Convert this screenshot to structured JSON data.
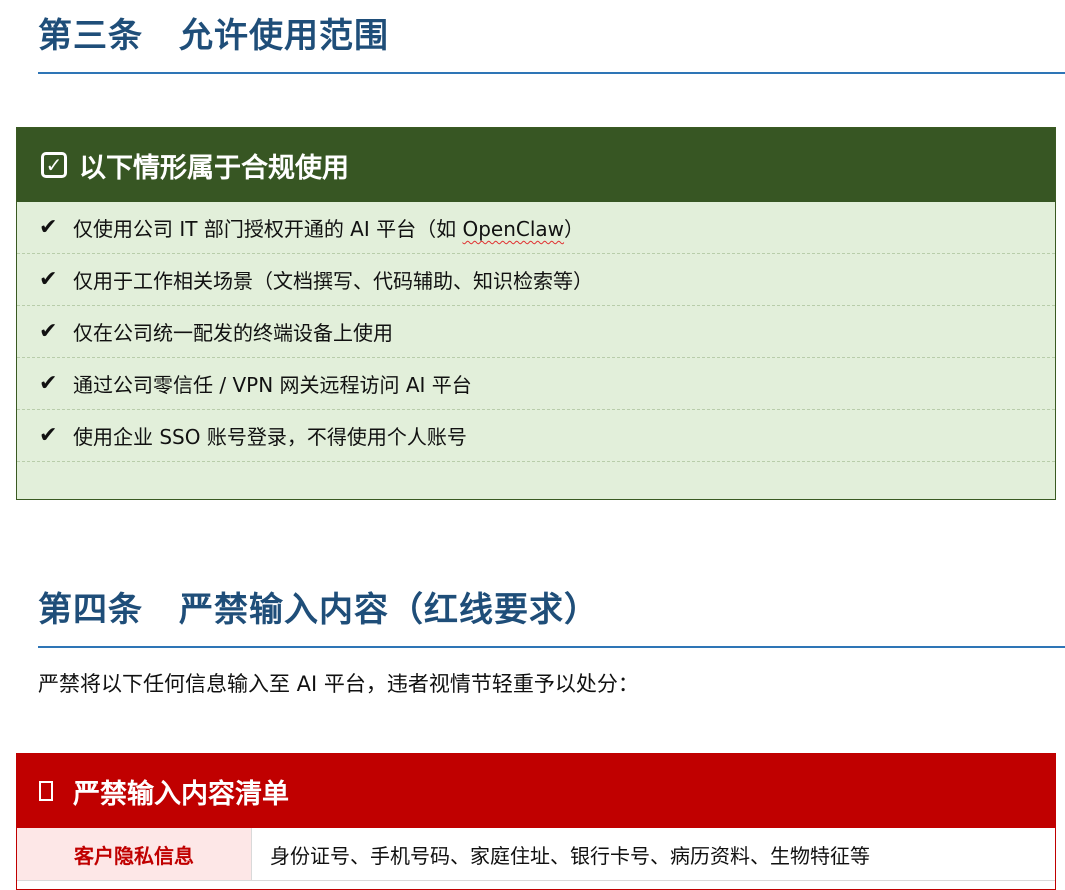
{
  "section3": {
    "number": "第三条",
    "title": "允许使用范围",
    "box": {
      "icon": "checkbox-checked-icon",
      "title": "以下情形属于合规使用",
      "items": [
        {
          "before": "仅使用公司 IT 部门授权开通的 AI 平台（如 ",
          "highlight": "OpenClaw",
          "after": "）"
        },
        {
          "before": "仅用于工作相关场景（文档撰写、代码辅助、知识检索等）",
          "highlight": "",
          "after": ""
        },
        {
          "before": "仅在公司统一配发的终端设备上使用",
          "highlight": "",
          "after": ""
        },
        {
          "before": "通过公司零信任 / VPN 网关远程访问 AI 平台",
          "highlight": "",
          "after": ""
        },
        {
          "before": "使用企业 SSO 账号登录，不得使用个人账号",
          "highlight": "",
          "after": ""
        }
      ]
    }
  },
  "section4": {
    "number": "第四条",
    "title": "严禁输入内容（红线要求）",
    "intro": "严禁将以下任何信息输入至 AI 平台，违者视情节轻重予以处分：",
    "box": {
      "icon": "empty-square-icon",
      "title": "严禁输入内容清单",
      "rows": [
        {
          "category": "客户隐私信息",
          "description": "身份证号、手机号码、家庭住址、银行卡号、病历资料、生物特征等"
        }
      ]
    }
  },
  "colors": {
    "heading": "#1f4e79",
    "green_header": "#375623",
    "green_bg": "#e2efda",
    "red_header": "#c00000",
    "red_cell_bg": "#fde7e7"
  }
}
